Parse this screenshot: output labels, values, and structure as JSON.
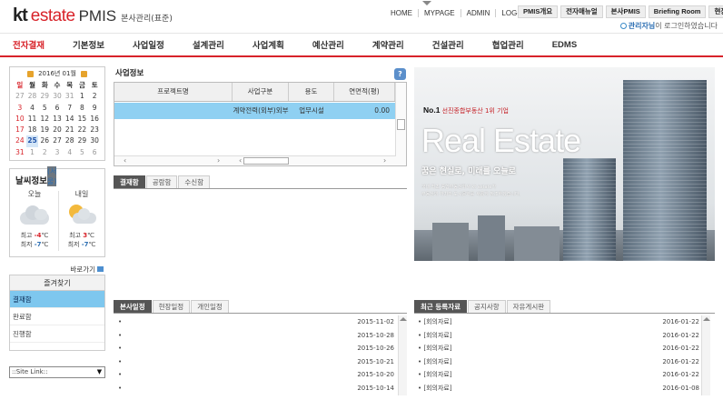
{
  "header": {
    "logo_kt": "kt",
    "logo_estate": "estate",
    "logo_pmis": "PMIS",
    "logo_sub": "본사관리(표준)",
    "top_links": [
      "HOME",
      "MYPAGE",
      "ADMIN",
      "LOG-OUT"
    ],
    "system_tabs": [
      "PMIS개요",
      "전자매뉴얼",
      "본사PMIS",
      "Briefing Room",
      "현장PMIS"
    ],
    "user_name": "관리자님",
    "user_suffix": "이 로그인하였습니다"
  },
  "nav": {
    "items": [
      "전자결재",
      "기본정보",
      "사업일정",
      "설계관리",
      "사업계획",
      "예산관리",
      "계약관리",
      "건설관리",
      "협업관리",
      "EDMS"
    ],
    "active_index": 0
  },
  "calendar": {
    "title": "2016년 01월",
    "weekdays": [
      "일",
      "월",
      "화",
      "수",
      "목",
      "금",
      "토"
    ],
    "weeks": [
      [
        "27",
        "28",
        "29",
        "30",
        "31",
        "1",
        "2"
      ],
      [
        "3",
        "4",
        "5",
        "6",
        "7",
        "8",
        "9"
      ],
      [
        "10",
        "11",
        "12",
        "13",
        "14",
        "15",
        "16"
      ],
      [
        "17",
        "18",
        "19",
        "20",
        "21",
        "22",
        "23"
      ],
      [
        "24",
        "25",
        "26",
        "27",
        "28",
        "29",
        "30"
      ],
      [
        "31",
        "1",
        "2",
        "3",
        "4",
        "5",
        "6"
      ]
    ],
    "today": "25"
  },
  "weather": {
    "title": "날씨정보",
    "city": "(서울)",
    "today": {
      "label": "오늘",
      "high_label": "최고",
      "high": "-4",
      "low_label": "최저",
      "low": "-7",
      "unit": "℃",
      "icon": "cloud-icon"
    },
    "tomorrow": {
      "label": "내일",
      "high_label": "최고",
      "high": "3",
      "low_label": "최저",
      "low": "-7",
      "unit": "℃",
      "icon": "partly-cloudy-icon"
    }
  },
  "quick": {
    "shortcut_label": "바로가기",
    "favorites_title": "즐겨찾기",
    "items": [
      "결재함",
      "완료함",
      "진행함"
    ],
    "selected_index": 0
  },
  "site_link": {
    "label": "::Site Link::"
  },
  "project": {
    "title": "사업정보",
    "columns": [
      "프로젝트명",
      "사업구분",
      "용도",
      "연면적(평)"
    ],
    "rows": [
      [
        "",
        "계약전력(외부)외부",
        "업무시설",
        "0.00"
      ]
    ]
  },
  "approval_tabs": [
    "결재함",
    "공람함",
    "수신함"
  ],
  "banner": {
    "no1": "No.1",
    "no1_text": "선진종합부동산 1위 기업",
    "headline": "Real Estate",
    "slogan": "꿈은 현실로, 미래를 오늘로",
    "small_line1": "국내 최초 종합부동산회사 kt estate가",
    "small_line2": "부동산의 가치와 도시문화를 새롭게 창조하겠습니다."
  },
  "schedule": {
    "tabs": [
      "본사일정",
      "현장일정",
      "개인일정"
    ],
    "items": [
      {
        "title": "",
        "date": "2015-11-02"
      },
      {
        "title": "",
        "date": "2015-10-28"
      },
      {
        "title": "",
        "date": "2015-10-26"
      },
      {
        "title": "",
        "date": "2015-10-21"
      },
      {
        "title": "",
        "date": "2015-10-20"
      },
      {
        "title": "",
        "date": "2015-10-14"
      }
    ]
  },
  "recent": {
    "tabs": [
      "최근 등록자료",
      "공지사항",
      "자유게시판"
    ],
    "items": [
      {
        "title": "[회의자료]",
        "date": "2016-01-22"
      },
      {
        "title": "[회의자료]",
        "date": "2016-01-22"
      },
      {
        "title": "[회의자료]",
        "date": "2016-01-22"
      },
      {
        "title": "[회의자료]",
        "date": "2016-01-22"
      },
      {
        "title": "[회의자료]",
        "date": "2016-01-22"
      },
      {
        "title": "[회의자료]",
        "date": "2016-01-08"
      }
    ]
  },
  "colors": {
    "brand_red": "#d8232a",
    "selected_row": "#8fd0f2",
    "tab_active": "#555555"
  }
}
